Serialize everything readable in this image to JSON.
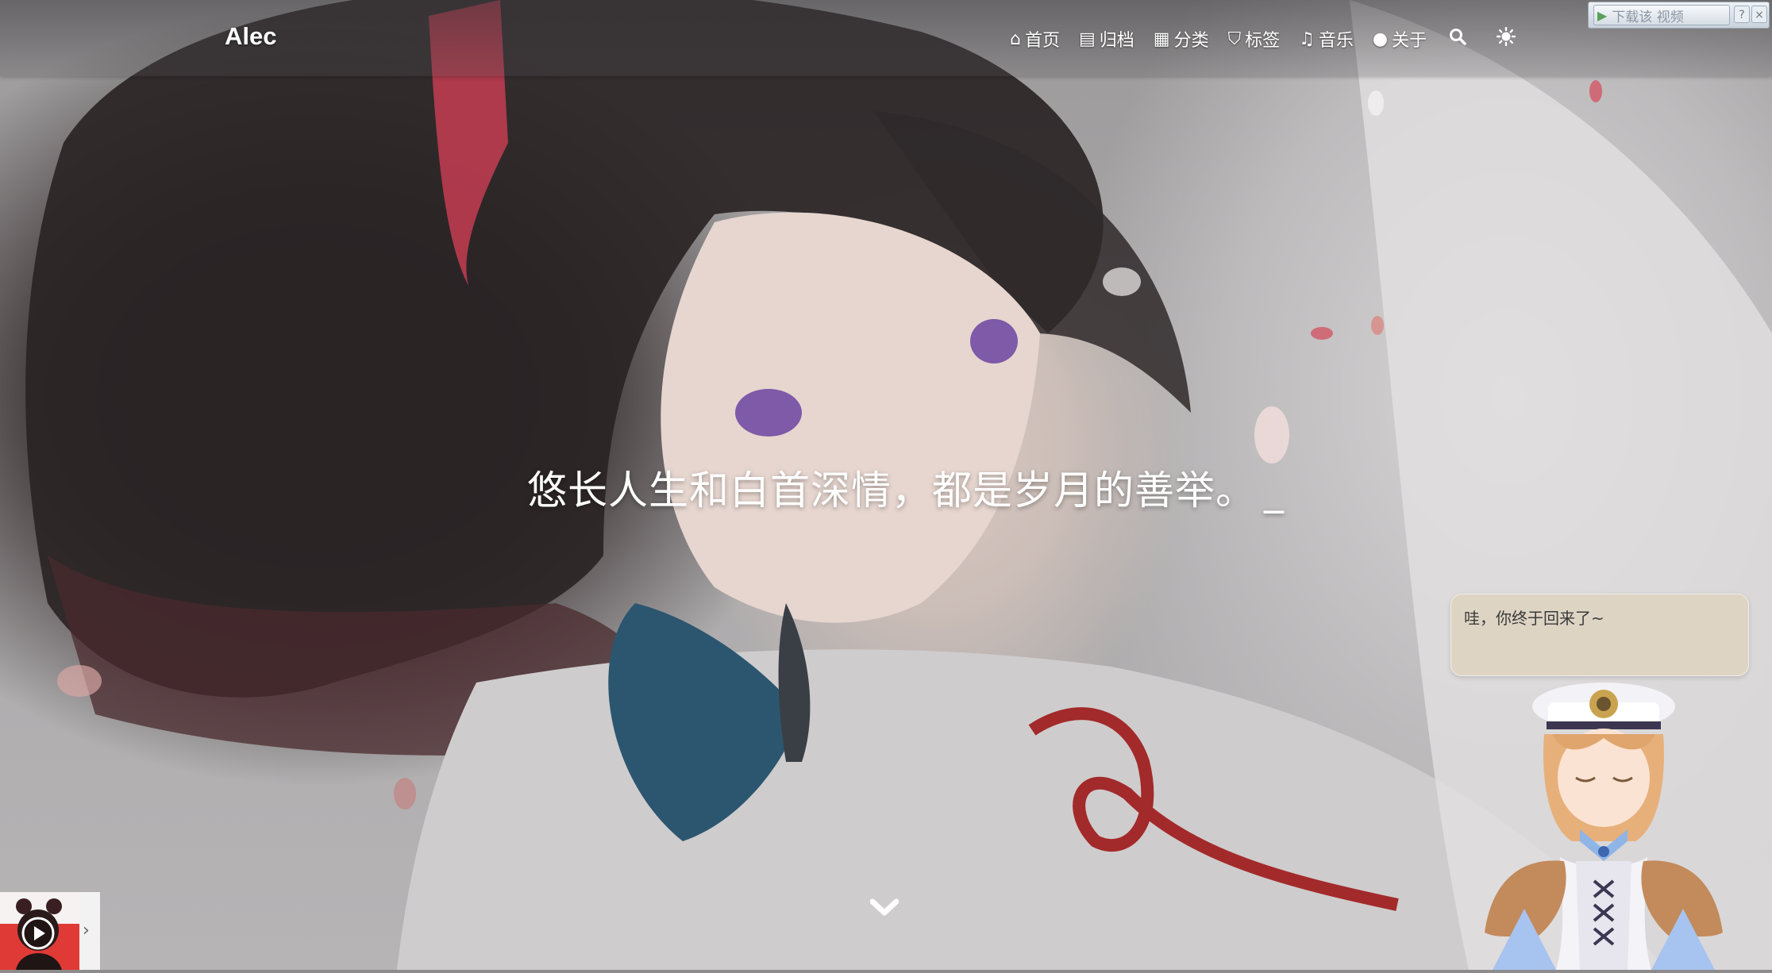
{
  "site": {
    "title": "Alec"
  },
  "nav": {
    "items": [
      {
        "icon": "home-icon",
        "glyph": "⌂",
        "label": "首页"
      },
      {
        "icon": "archive-icon",
        "glyph": "▤",
        "label": "归档"
      },
      {
        "icon": "category-icon",
        "glyph": "▦",
        "label": "分类"
      },
      {
        "icon": "tag-icon",
        "glyph": "⛉",
        "label": "标签"
      },
      {
        "icon": "music-icon",
        "glyph": "♫",
        "label": "音乐"
      },
      {
        "icon": "user-icon",
        "glyph": "●",
        "label": "关于"
      }
    ],
    "search_icon": "search-icon",
    "theme_icon": "sun-icon"
  },
  "hero": {
    "subtitle": "悠长人生和白首深情，都是岁月的善举。",
    "cursor": "_"
  },
  "download_bar": {
    "label": "下载该 视频",
    "help": "?",
    "close": "×"
  },
  "live2d": {
    "message": "哇，你终于回来了~"
  },
  "music_player": {
    "toggle": "›"
  },
  "colors": {
    "nav_text": "#ffffff",
    "bubble_bg": "#ded2be"
  }
}
